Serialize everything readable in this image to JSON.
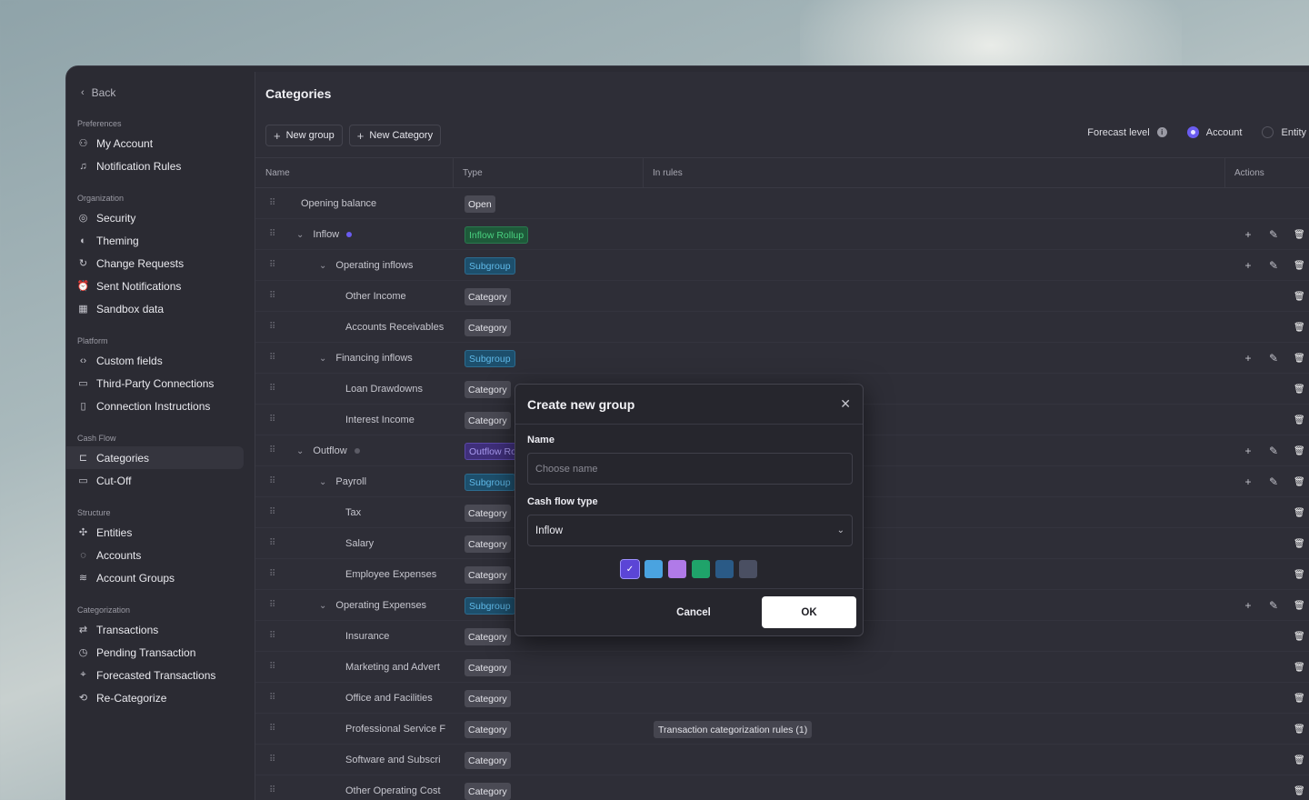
{
  "sidebar": {
    "back_label": "Back",
    "sections": [
      {
        "title": "Preferences",
        "items": [
          {
            "label": "My Account",
            "icon": "user-icon"
          },
          {
            "label": "Notification Rules",
            "icon": "bell-icon"
          }
        ]
      },
      {
        "title": "Organization",
        "items": [
          {
            "label": "Security",
            "icon": "fingerprint-icon"
          },
          {
            "label": "Theming",
            "icon": "palette-icon"
          },
          {
            "label": "Change Requests",
            "icon": "refresh-icon"
          },
          {
            "label": "Sent Notifications",
            "icon": "alarm-icon"
          },
          {
            "label": "Sandbox data",
            "icon": "grid-icon"
          }
        ]
      },
      {
        "title": "Platform",
        "items": [
          {
            "label": "Custom fields",
            "icon": "code-icon"
          },
          {
            "label": "Third-Party Connections",
            "icon": "calendar-icon"
          },
          {
            "label": "Connection Instructions",
            "icon": "book-icon"
          }
        ]
      },
      {
        "title": "Cash Flow",
        "items": [
          {
            "label": "Categories",
            "icon": "tag-icon",
            "active": true
          },
          {
            "label": "Cut-Off",
            "icon": "calendar-icon"
          }
        ]
      },
      {
        "title": "Structure",
        "items": [
          {
            "label": "Entities",
            "icon": "nodes-icon"
          },
          {
            "label": "Accounts",
            "icon": "coins-icon"
          },
          {
            "label": "Account Groups",
            "icon": "layers-icon"
          }
        ]
      },
      {
        "title": "Categorization",
        "items": [
          {
            "label": "Transactions",
            "icon": "swap-icon"
          },
          {
            "label": "Pending Transaction",
            "icon": "clock-icon"
          },
          {
            "label": "Forecasted Transactions",
            "icon": "telescope-icon"
          },
          {
            "label": "Re-Categorize",
            "icon": "repeat-icon"
          }
        ]
      }
    ]
  },
  "main": {
    "title": "Categories",
    "new_group_label": "New group",
    "new_category_label": "New Category",
    "forecast_label": "Forecast level",
    "forecast_options": [
      "Account",
      "Entity"
    ],
    "forecast_selected": "Account"
  },
  "table": {
    "columns": [
      "Name",
      "Type",
      "In rules",
      "Actions"
    ],
    "rows": [
      {
        "name": "Opening balance",
        "indent": 0,
        "type": "Open",
        "kind": "open",
        "caret": false,
        "dot": null,
        "actions": [],
        "rules": ""
      },
      {
        "name": "Inflow",
        "indent": 1,
        "type": "Inflow Rollup",
        "kind": "inflow",
        "caret": true,
        "dot": "#6a5cf0",
        "actions": [
          "plus",
          "edit",
          "trash"
        ],
        "rules": ""
      },
      {
        "name": "Operating inflows",
        "indent": 2,
        "type": "Subgroup",
        "kind": "sub",
        "caret": true,
        "dot": null,
        "actions": [
          "plus",
          "edit",
          "trash"
        ],
        "rules": ""
      },
      {
        "name": "Other Income",
        "indent": 3,
        "type": "Category",
        "kind": "cat",
        "caret": false,
        "dot": null,
        "actions": [
          "trash"
        ],
        "rules": ""
      },
      {
        "name": "Accounts Receivables",
        "indent": 3,
        "type": "Category",
        "kind": "cat",
        "caret": false,
        "dot": null,
        "actions": [
          "trash"
        ],
        "rules": ""
      },
      {
        "name": "Financing inflows",
        "indent": 2,
        "type": "Subgroup",
        "kind": "sub",
        "caret": true,
        "dot": null,
        "actions": [
          "plus",
          "edit",
          "trash"
        ],
        "rules": ""
      },
      {
        "name": "Loan Drawdowns",
        "indent": 3,
        "type": "Category",
        "kind": "cat",
        "caret": false,
        "dot": null,
        "actions": [
          "trash"
        ],
        "rules": ""
      },
      {
        "name": "Interest Income",
        "indent": 3,
        "type": "Category",
        "kind": "cat",
        "caret": false,
        "dot": null,
        "actions": [
          "trash"
        ],
        "rules": ""
      },
      {
        "name": "Outflow",
        "indent": 1,
        "type": "Outflow Ro",
        "kind": "outflow",
        "caret": true,
        "dot": "#5c5c66",
        "actions": [
          "plus",
          "edit",
          "trash"
        ],
        "rules": ""
      },
      {
        "name": "Payroll",
        "indent": 2,
        "type": "Subgroup",
        "kind": "sub",
        "caret": true,
        "dot": null,
        "actions": [
          "plus",
          "edit",
          "trash"
        ],
        "rules": ""
      },
      {
        "name": "Tax",
        "indent": 3,
        "type": "Category",
        "kind": "cat",
        "caret": false,
        "dot": null,
        "actions": [
          "trash"
        ],
        "rules": ""
      },
      {
        "name": "Salary",
        "indent": 3,
        "type": "Category",
        "kind": "cat",
        "caret": false,
        "dot": null,
        "actions": [
          "trash"
        ],
        "rules": ""
      },
      {
        "name": "Employee Expenses",
        "indent": 3,
        "type": "Category",
        "kind": "cat",
        "caret": false,
        "dot": null,
        "actions": [
          "trash"
        ],
        "rules": ""
      },
      {
        "name": "Operating Expenses",
        "indent": 2,
        "type": "Subgroup",
        "kind": "sub",
        "caret": true,
        "dot": null,
        "actions": [
          "plus",
          "edit",
          "trash"
        ],
        "rules": ""
      },
      {
        "name": "Insurance",
        "indent": 3,
        "type": "Category",
        "kind": "cat",
        "caret": false,
        "dot": null,
        "actions": [
          "trash"
        ],
        "rules": ""
      },
      {
        "name": "Marketing and Advert",
        "indent": 3,
        "type": "Category",
        "kind": "cat",
        "caret": false,
        "dot": null,
        "actions": [
          "trash"
        ],
        "rules": ""
      },
      {
        "name": "Office and Facilities",
        "indent": 3,
        "type": "Category",
        "kind": "cat",
        "caret": false,
        "dot": null,
        "actions": [
          "trash"
        ],
        "rules": ""
      },
      {
        "name": "Professional Service F",
        "indent": 3,
        "type": "Category",
        "kind": "cat",
        "caret": false,
        "dot": null,
        "actions": [
          "trash"
        ],
        "rules": "Transaction categorization rules (1)"
      },
      {
        "name": "Software and Subscri",
        "indent": 3,
        "type": "Category",
        "kind": "cat",
        "caret": false,
        "dot": null,
        "actions": [
          "trash"
        ],
        "rules": ""
      },
      {
        "name": "Other Operating Cost",
        "indent": 3,
        "type": "Category",
        "kind": "cat",
        "caret": false,
        "dot": null,
        "actions": [
          "trash"
        ],
        "rules": ""
      }
    ]
  },
  "modal": {
    "title": "Create new group",
    "name_label": "Name",
    "name_placeholder": "Choose name",
    "cashflow_label": "Cash flow type",
    "cashflow_value": "Inflow",
    "colors": [
      "#5b45d6",
      "#4aa3e0",
      "#b07ae8",
      "#1fa36a",
      "#2a5a86",
      "#4a4f62"
    ],
    "selected_color": "#5b45d6",
    "cancel_label": "Cancel",
    "ok_label": "OK"
  }
}
